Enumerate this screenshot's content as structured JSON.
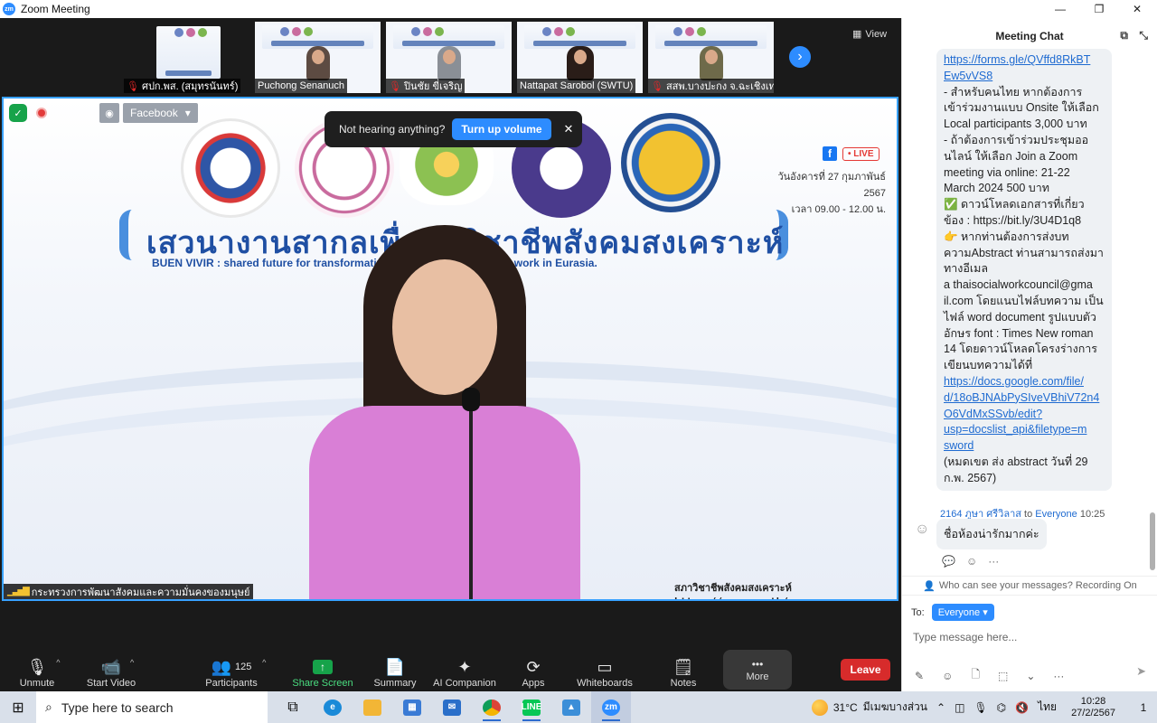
{
  "window": {
    "logo_text": "zm",
    "title": "Zoom Meeting",
    "min_icon": "—",
    "max_icon": "❐",
    "close_icon": "✕"
  },
  "thumbnails": [
    {
      "name": "ศปก.พส. (สมุทรนันทร์)",
      "muted": true,
      "has_person": false
    },
    {
      "name": "Puchong Senanuch",
      "muted": false,
      "has_person": true
    },
    {
      "name": "ปินชัย ขี่เจริญ",
      "muted": true,
      "has_person": true
    },
    {
      "name": "Nattapat Sarobol (SWTU)",
      "muted": false,
      "has_person": true
    },
    {
      "name": "สสพ.บางปะกง จ.ฉะเชิงเทรา",
      "muted": true,
      "has_person": true
    }
  ],
  "view_label": "View",
  "next_icon": "›",
  "stage": {
    "facebook_label": "Facebook",
    "rss_icon": "rss-icon",
    "live_label": "• LIVE",
    "date_line1": "วันอังคารที่ 27 กุมภาพันธ์ 2567",
    "date_line2": "เวลา 09.00 - 12.00 น.",
    "title_thai": "เสวนางานสากลเพื่อนักวิชาชีพสังคมสงเคราะห์",
    "title_sub": "BUEN VIVIR : shared future for transformative ... perspective of social work in Eurasia.",
    "website": "สภาวิชาชีพสังคมสงเคราะห์ https://swpc.or.th/",
    "caption": "กระทรวงการพัฒนาสังคมและความมั่นคงของมนุษย์",
    "volume_prompt": "Not hearing anything?",
    "volume_button": "Turn up volume",
    "volume_close": "✕"
  },
  "toolbar": {
    "unmute": "Unmute",
    "start_video": "Start Video",
    "participants": "Participants",
    "participants_count": "125",
    "share_screen": "Share Screen",
    "summary": "Summary",
    "ai_companion": "AI Companion",
    "apps": "Apps",
    "whiteboards": "Whiteboards",
    "notes": "Notes",
    "more": "More",
    "more_icon": "•••",
    "leave": "Leave"
  },
  "chat": {
    "title": "Meeting Chat",
    "message_lines": [
      {
        "text": "https://forms.gle/QVffd8RkBT",
        "link": true
      },
      {
        "text": "Ew5vVS8",
        "link": true
      },
      {
        "text": "    - สำหรับคนไทย หากต้องการ",
        "link": false
      },
      {
        "text": "เข้าร่วมงานแบบ Onsite ให้เลือก",
        "link": false
      },
      {
        "text": "Local participants 3,000 บาท",
        "link": false
      },
      {
        "text": "    - ถ้าต้องการเข้าร่วมประชุมออ",
        "link": false
      },
      {
        "text": "นไลน์ ให้เลือก Join a Zoom",
        "link": false
      },
      {
        "text": "meeting via online: 21-22",
        "link": false
      },
      {
        "text": "March 2024 500 บาท",
        "link": false
      },
      {
        "text": "✅ ดาวน์โหลดเอกสารที่เกี่ยว",
        "link": false
      },
      {
        "text": "ข้อง : https://bit.ly/3U4D1q8",
        "link": false
      },
      {
        "text": "👉 หากท่านต้องการส่งบท",
        "link": false
      },
      {
        "text": "ความAbstract ท่านสามารถส่งมา",
        "link": false
      },
      {
        "text": "ทางอีเมล",
        "link": false
      },
      {
        "text": "a thaisocialworkcouncil@gma",
        "link": false
      },
      {
        "text": "il.com โดยแนบไฟล์บทความ เป็น",
        "link": false
      },
      {
        "text": "ไฟล์ word document รูปแบบตัว",
        "link": false
      },
      {
        "text": "อักษร font : Times New roman",
        "link": false
      },
      {
        "text": "14  โดยดาวน์โหลดโครงร่างการ",
        "link": false
      },
      {
        "text": "เขียนบทความได้ที่",
        "link": false
      },
      {
        "text": "https://docs.google.com/file/",
        "link": true
      },
      {
        "text": "d/18oBJNAbPySIveVBhiV72n4",
        "link": true
      },
      {
        "text": "O6VdMxSSvb/edit?",
        "link": true
      },
      {
        "text": "usp=docslist_api&filetype=m",
        "link": true
      },
      {
        "text": "sword",
        "link": true
      },
      {
        "text": "(หมดเขต ส่ง abstract วันที่ 29",
        "link": false
      },
      {
        "text": "ก.พ. 2567)",
        "link": false
      }
    ],
    "last_sender": "2164 ภูษา ศรีวิลาส",
    "to_word": "to",
    "last_target": "Everyone",
    "last_time": "10:25",
    "last_message": "ชื่อห้องน่ารักมากค่ะ",
    "visibility_note": "Who can see your messages? Recording On",
    "to_label": "To:",
    "to_value": "Everyone",
    "input_placeholder": "Type message here..."
  },
  "taskbar": {
    "search_placeholder": "Type here to search",
    "temperature": "31°C",
    "weather_text": "มีเมฆบางส่วน",
    "language": "ไทย",
    "time": "10:28",
    "date": "27/2/2567",
    "notification_count": "1"
  }
}
